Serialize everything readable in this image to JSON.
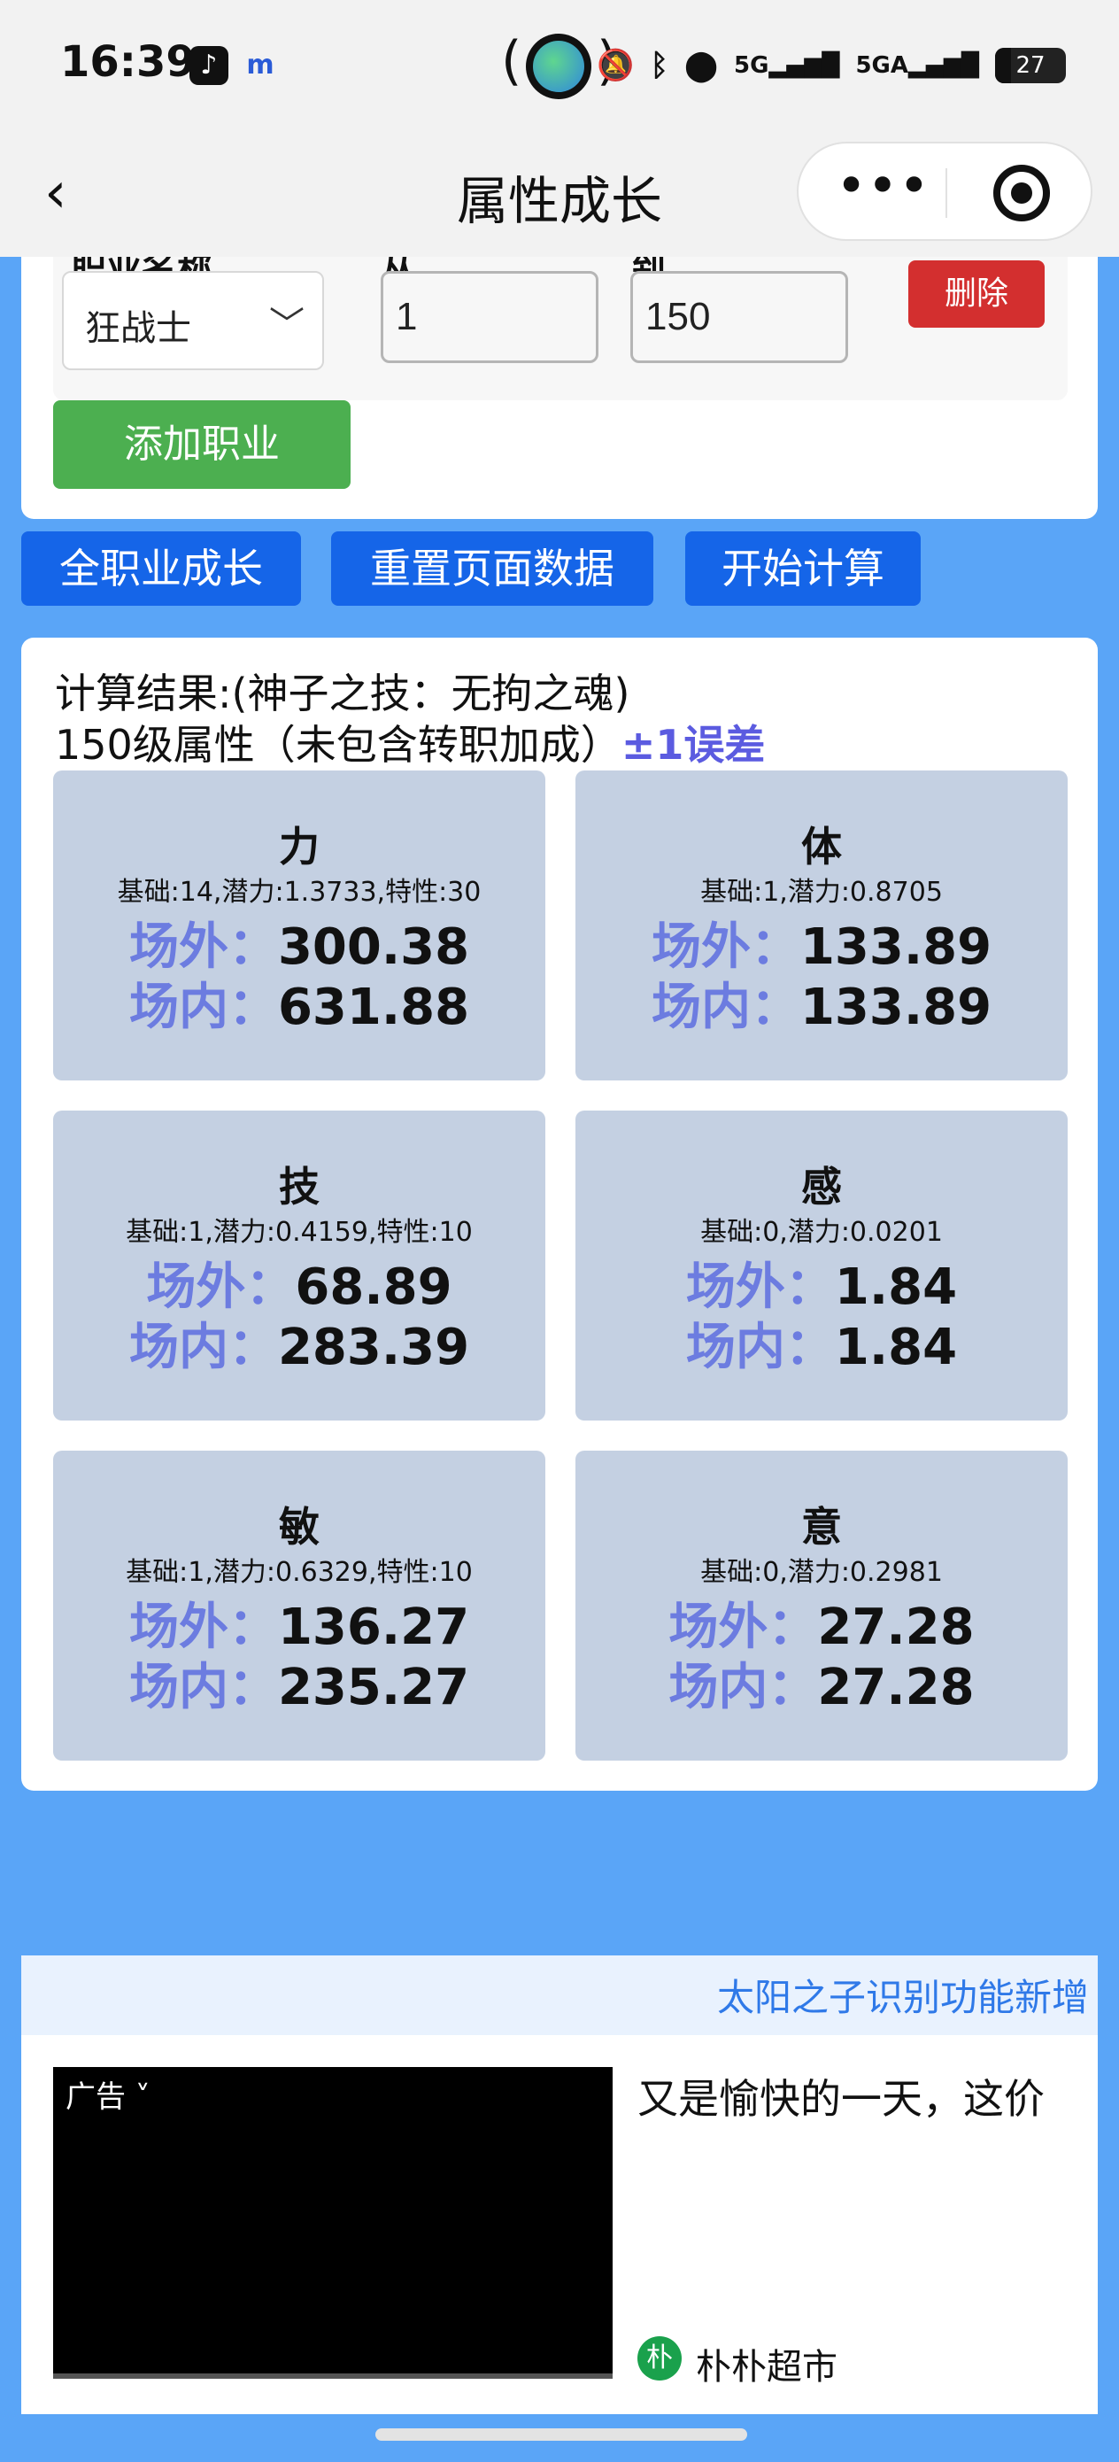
{
  "status_bar": {
    "time": "16:39",
    "app1": "♪",
    "app2": "m",
    "right_icons": [
      "mute-icon",
      "bluetooth-icon",
      "location-icon",
      "5g-signal-icon",
      "5ga-signal-icon"
    ],
    "signal1": "5G",
    "signal2": "5GA",
    "battery": "27"
  },
  "nav": {
    "title": "属性成长",
    "back": "‹",
    "more": "•••"
  },
  "job": {
    "label_cut_1": "职业名称",
    "label_cut_2": "从",
    "label_cut_3": "到",
    "selected_job": "狂战士",
    "from_level": "1",
    "to_level": "150",
    "delete_label": "删除",
    "add_label": "添加职业"
  },
  "actions": {
    "all_growth": "全职业成长",
    "reset": "重置页面数据",
    "calculate": "开始计算"
  },
  "result": {
    "line1": "计算结果:(神子之技：无拘之魂)",
    "line2": "150级属性（未包含转职加成）",
    "error_note": "±1误差",
    "outside_label": "场外：",
    "inside_label": "场内：",
    "attributes": [
      {
        "name": "力",
        "detail": "基础:14,潜力:1.3733,特性:30",
        "outside": "300.38",
        "inside": "631.88"
      },
      {
        "name": "体",
        "detail": "基础:1,潜力:0.8705",
        "outside": "133.89",
        "inside": "133.89"
      },
      {
        "name": "技",
        "detail": "基础:1,潜力:0.4159,特性:10",
        "outside": "68.89",
        "inside": "283.39"
      },
      {
        "name": "感",
        "detail": "基础:0,潜力:0.0201",
        "outside": "1.84",
        "inside": "1.84"
      },
      {
        "name": "敏",
        "detail": "基础:1,潜力:0.6329,特性:10",
        "outside": "136.27",
        "inside": "235.27"
      },
      {
        "name": "意",
        "detail": "基础:0,潜力:0.2981",
        "outside": "27.28",
        "inside": "27.28"
      }
    ]
  },
  "notice": "太阳之子识别功能新增",
  "ad": {
    "tag": "广告",
    "text": "又是愉快的一天，这价",
    "brand_icon": "朴",
    "brand": "朴朴超市"
  }
}
